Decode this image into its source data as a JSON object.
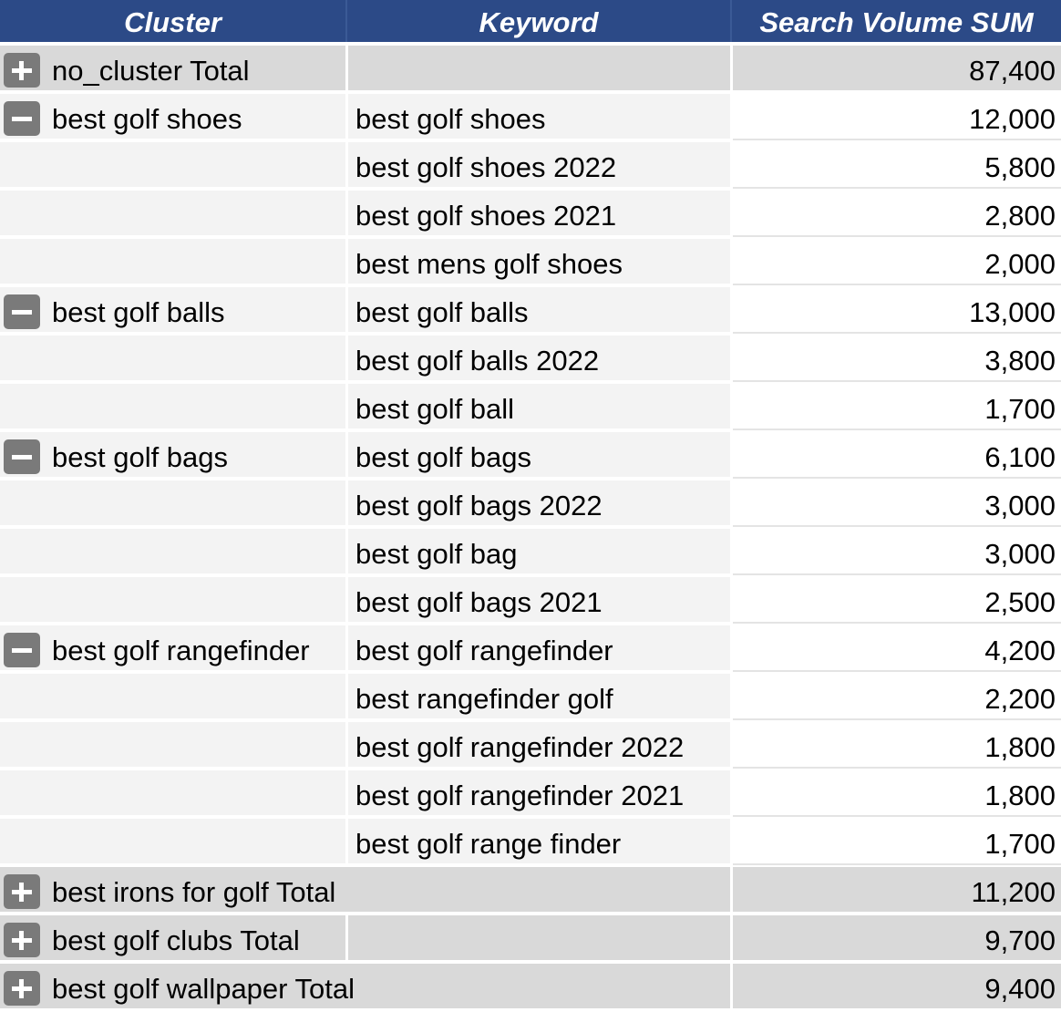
{
  "header": {
    "cluster": "Cluster",
    "keyword": "Keyword",
    "sum": "Search Volume SUM"
  },
  "rows": [
    {
      "kind": "total",
      "toggle": "expand",
      "cluster": "no_cluster Total",
      "keyword": "",
      "value": "87,400",
      "span": false
    },
    {
      "kind": "group",
      "toggle": "collapse",
      "cluster": "best golf shoes",
      "keyword": "best golf shoes",
      "value": "12,000"
    },
    {
      "kind": "cont",
      "cluster": "",
      "keyword": "best golf shoes 2022",
      "value": "5,800"
    },
    {
      "kind": "cont",
      "cluster": "",
      "keyword": "best golf shoes 2021",
      "value": "2,800"
    },
    {
      "kind": "cont",
      "cluster": "",
      "keyword": "best mens golf shoes",
      "value": "2,000"
    },
    {
      "kind": "group",
      "toggle": "collapse",
      "cluster": "best golf balls",
      "keyword": "best golf balls",
      "value": "13,000"
    },
    {
      "kind": "cont",
      "cluster": "",
      "keyword": "best golf balls 2022",
      "value": "3,800"
    },
    {
      "kind": "cont",
      "cluster": "",
      "keyword": "best golf ball",
      "value": "1,700"
    },
    {
      "kind": "group",
      "toggle": "collapse",
      "cluster": "best golf bags",
      "keyword": "best golf bags",
      "value": "6,100"
    },
    {
      "kind": "cont",
      "cluster": "",
      "keyword": "best golf bags 2022",
      "value": "3,000"
    },
    {
      "kind": "cont",
      "cluster": "",
      "keyword": "best golf bag",
      "value": "3,000"
    },
    {
      "kind": "cont",
      "cluster": "",
      "keyword": "best golf bags 2021",
      "value": "2,500"
    },
    {
      "kind": "group",
      "toggle": "collapse",
      "cluster": "best golf rangefinder",
      "keyword": "best golf rangefinder",
      "value": "4,200"
    },
    {
      "kind": "cont",
      "cluster": "",
      "keyword": "best rangefinder golf",
      "value": "2,200"
    },
    {
      "kind": "cont",
      "cluster": "",
      "keyword": "best golf rangefinder 2022",
      "value": "1,800"
    },
    {
      "kind": "cont",
      "cluster": "",
      "keyword": "best golf rangefinder 2021",
      "value": "1,800"
    },
    {
      "kind": "cont",
      "cluster": "",
      "keyword": "best golf range finder",
      "value": "1,700"
    },
    {
      "kind": "total",
      "toggle": "expand",
      "cluster": "best irons for golf Total",
      "keyword": "",
      "value": "11,200",
      "span": true
    },
    {
      "kind": "total",
      "toggle": "expand",
      "cluster": "best golf clubs Total",
      "keyword": "",
      "value": "9,700",
      "span": false
    },
    {
      "kind": "total",
      "toggle": "expand",
      "cluster": "best golf wallpaper Total",
      "keyword": "",
      "value": "9,400",
      "span": true
    }
  ]
}
